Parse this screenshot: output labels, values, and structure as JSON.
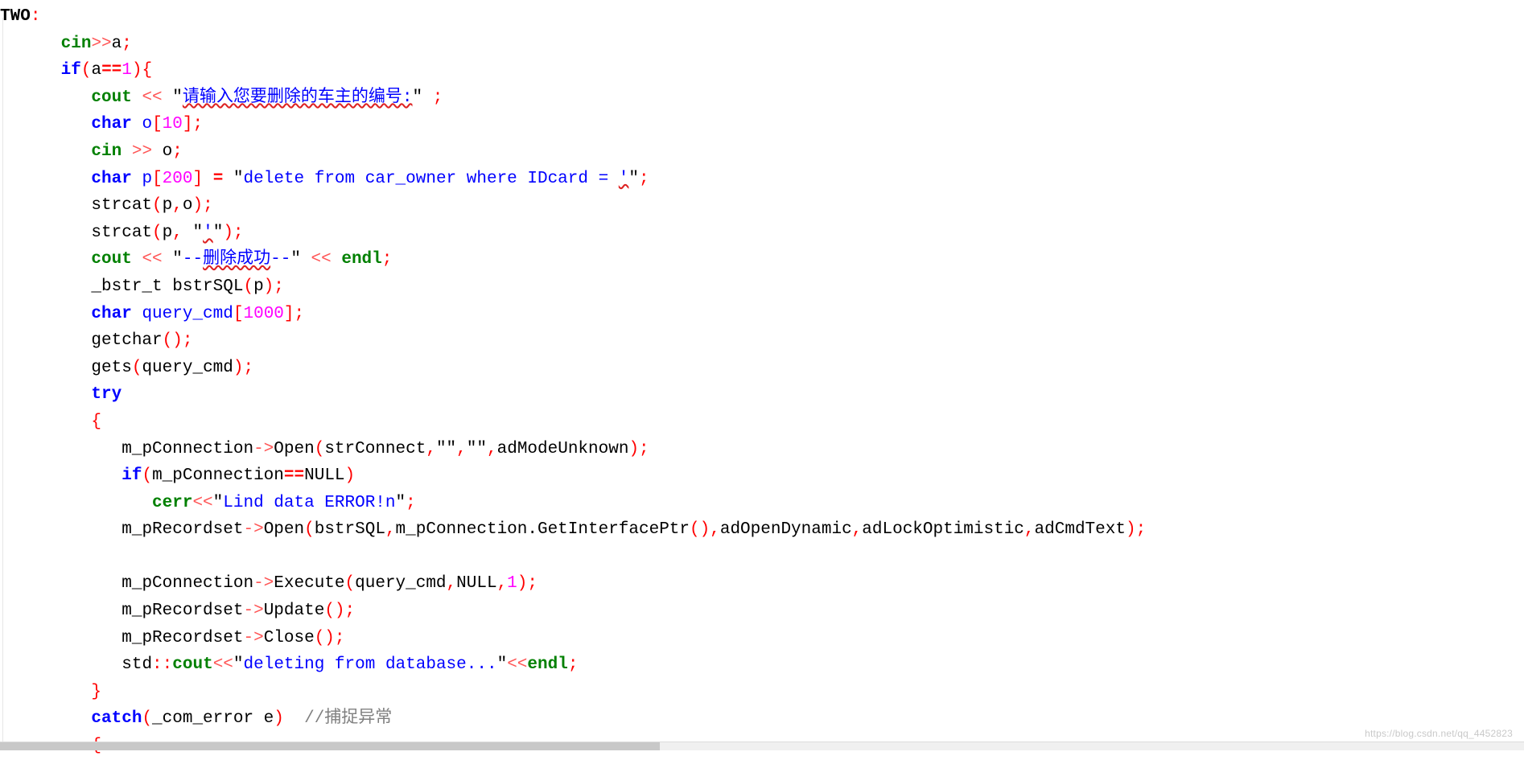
{
  "editor": {
    "language": "C++",
    "background_color": "#ffffff",
    "font_size_px": 21,
    "colors": {
      "keyword": "#0000ff",
      "stream_object": "#008000",
      "operator": "#ff5555",
      "punctuation": "#ff0000",
      "number": "#ff00ff",
      "string": "#0000ff",
      "comment": "#808080",
      "plain_text": "#000000",
      "spell_squiggle": "#dd2222"
    }
  },
  "watermark": {
    "text": "https://blog.csdn.net/qq_4452823"
  },
  "code": {
    "lines": [
      {
        "id": "line-label-two",
        "indent": 0,
        "text": "TWO:",
        "tokens": [
          {
            "t": "TWO",
            "c": "label"
          },
          {
            "t": ":",
            "c": "punct"
          }
        ]
      },
      {
        "id": "line-cin-a",
        "indent": 6,
        "text": "cin>>a;",
        "tokens": [
          {
            "t": "cin",
            "c": "stream"
          },
          {
            "t": ">>",
            "c": "op"
          },
          {
            "t": "a",
            "c": "ident"
          },
          {
            "t": ";",
            "c": "punct"
          }
        ]
      },
      {
        "id": "line-if-a-eq-1",
        "indent": 6,
        "text": "if(a==1){",
        "tokens": [
          {
            "t": "if",
            "c": "kw"
          },
          {
            "t": "(",
            "c": "punct"
          },
          {
            "t": "a",
            "c": "ident"
          },
          {
            "t": "==",
            "c": "eq"
          },
          {
            "t": "1",
            "c": "num"
          },
          {
            "t": ")",
            "c": "punct"
          },
          {
            "t": "{",
            "c": "brace"
          }
        ]
      },
      {
        "id": "line-cout-prompt",
        "indent": 9,
        "text": "cout << \"请输入您要删除的车主的编号:\" ;",
        "tokens": [
          {
            "t": "cout",
            "c": "stream"
          },
          {
            "t": " << ",
            "c": "op"
          },
          {
            "t": "\"",
            "c": "strq"
          },
          {
            "t": "请输入您要删除的车主的编号:",
            "c": "cn squiggle"
          },
          {
            "t": "\"",
            "c": "strq"
          },
          {
            "t": " ;",
            "c": "punct"
          }
        ]
      },
      {
        "id": "line-char-o-10",
        "indent": 9,
        "text": "char o[10];",
        "tokens": [
          {
            "t": "char",
            "c": "kw"
          },
          {
            "t": " o",
            "c": "type"
          },
          {
            "t": "[",
            "c": "punct"
          },
          {
            "t": "10",
            "c": "num"
          },
          {
            "t": "]",
            "c": "punct"
          },
          {
            "t": ";",
            "c": "punct"
          }
        ]
      },
      {
        "id": "line-cin-o",
        "indent": 9,
        "text": "cin >> o;",
        "tokens": [
          {
            "t": "cin",
            "c": "stream"
          },
          {
            "t": " >> ",
            "c": "op"
          },
          {
            "t": "o",
            "c": "ident"
          },
          {
            "t": ";",
            "c": "punct"
          }
        ]
      },
      {
        "id": "line-char-p-200",
        "indent": 9,
        "text": "char p[200] = \"delete from car_owner where IDcard = '\";",
        "tokens": [
          {
            "t": "char",
            "c": "kw"
          },
          {
            "t": " p",
            "c": "type"
          },
          {
            "t": "[",
            "c": "punct"
          },
          {
            "t": "200",
            "c": "num"
          },
          {
            "t": "]",
            "c": "punct"
          },
          {
            "t": " = ",
            "c": "eq"
          },
          {
            "t": "\"",
            "c": "strq"
          },
          {
            "t": "delete from car_owner where IDcard = ",
            "c": "str"
          },
          {
            "t": "'",
            "c": "str squiggle"
          },
          {
            "t": "\"",
            "c": "strq"
          },
          {
            "t": ";",
            "c": "punct"
          }
        ]
      },
      {
        "id": "line-strcat-p-o",
        "indent": 9,
        "text": "strcat(p,o);",
        "tokens": [
          {
            "t": "strcat",
            "c": "ident"
          },
          {
            "t": "(",
            "c": "punct"
          },
          {
            "t": "p",
            "c": "ident"
          },
          {
            "t": ",",
            "c": "punct"
          },
          {
            "t": "o",
            "c": "ident"
          },
          {
            "t": ")",
            "c": "punct"
          },
          {
            "t": ";",
            "c": "punct"
          }
        ]
      },
      {
        "id": "line-strcat-p-quote",
        "indent": 9,
        "text": "strcat(p, \"'\");",
        "tokens": [
          {
            "t": "strcat",
            "c": "ident"
          },
          {
            "t": "(",
            "c": "punct"
          },
          {
            "t": "p",
            "c": "ident"
          },
          {
            "t": ", ",
            "c": "punct"
          },
          {
            "t": "\"",
            "c": "strq"
          },
          {
            "t": "'",
            "c": "str squiggle"
          },
          {
            "t": "\"",
            "c": "strq"
          },
          {
            "t": ")",
            "c": "punct"
          },
          {
            "t": ";",
            "c": "punct"
          }
        ]
      },
      {
        "id": "line-cout-success",
        "indent": 9,
        "text": "cout << \"--删除成功--\" << endl;",
        "tokens": [
          {
            "t": "cout",
            "c": "stream"
          },
          {
            "t": " << ",
            "c": "op"
          },
          {
            "t": "\"",
            "c": "strq"
          },
          {
            "t": "--",
            "c": "str"
          },
          {
            "t": "删除成功",
            "c": "cn squiggle"
          },
          {
            "t": "--",
            "c": "str"
          },
          {
            "t": "\"",
            "c": "strq"
          },
          {
            "t": " << ",
            "c": "op"
          },
          {
            "t": "endl",
            "c": "stream"
          },
          {
            "t": ";",
            "c": "punct"
          }
        ]
      },
      {
        "id": "line-bstr-t",
        "indent": 9,
        "text": "_bstr_t bstrSQL(p);",
        "tokens": [
          {
            "t": "_bstr_t bstrSQL",
            "c": "ident"
          },
          {
            "t": "(",
            "c": "punct"
          },
          {
            "t": "p",
            "c": "ident"
          },
          {
            "t": ")",
            "c": "punct"
          },
          {
            "t": ";",
            "c": "punct"
          }
        ]
      },
      {
        "id": "line-char-query-cmd",
        "indent": 9,
        "text": "char query_cmd[1000];",
        "tokens": [
          {
            "t": "char",
            "c": "kw"
          },
          {
            "t": " query_cmd",
            "c": "type"
          },
          {
            "t": "[",
            "c": "punct"
          },
          {
            "t": "1000",
            "c": "num"
          },
          {
            "t": "]",
            "c": "punct"
          },
          {
            "t": ";",
            "c": "punct"
          }
        ]
      },
      {
        "id": "line-getchar",
        "indent": 9,
        "text": "getchar();",
        "tokens": [
          {
            "t": "getchar",
            "c": "ident"
          },
          {
            "t": "()",
            "c": "punct"
          },
          {
            "t": ";",
            "c": "punct"
          }
        ]
      },
      {
        "id": "line-gets",
        "indent": 9,
        "text": "gets(query_cmd);",
        "tokens": [
          {
            "t": "gets",
            "c": "ident"
          },
          {
            "t": "(",
            "c": "punct"
          },
          {
            "t": "query_cmd",
            "c": "ident"
          },
          {
            "t": ")",
            "c": "punct"
          },
          {
            "t": ";",
            "c": "punct"
          }
        ]
      },
      {
        "id": "line-try",
        "indent": 9,
        "text": "try",
        "tokens": [
          {
            "t": "try",
            "c": "kw"
          }
        ]
      },
      {
        "id": "line-try-open-brace",
        "indent": 9,
        "text": "{",
        "tokens": [
          {
            "t": "{",
            "c": "brace"
          }
        ]
      },
      {
        "id": "line-conn-open",
        "indent": 12,
        "text": "m_pConnection->Open(strConnect,\"\",\"\",adModeUnknown);",
        "tokens": [
          {
            "t": "m_pConnection",
            "c": "ident"
          },
          {
            "t": "->",
            "c": "op"
          },
          {
            "t": "Open",
            "c": "ident"
          },
          {
            "t": "(",
            "c": "punct"
          },
          {
            "t": "strConnect",
            "c": "ident"
          },
          {
            "t": ",",
            "c": "punct"
          },
          {
            "t": "\"\"",
            "c": "strq"
          },
          {
            "t": ",",
            "c": "punct"
          },
          {
            "t": "\"\"",
            "c": "strq"
          },
          {
            "t": ",",
            "c": "punct"
          },
          {
            "t": "adModeUnknown",
            "c": "ident"
          },
          {
            "t": ")",
            "c": "punct"
          },
          {
            "t": ";",
            "c": "punct"
          }
        ]
      },
      {
        "id": "line-if-conn-null",
        "indent": 12,
        "text": "if(m_pConnection==NULL)",
        "tokens": [
          {
            "t": "if",
            "c": "kw"
          },
          {
            "t": "(",
            "c": "punct"
          },
          {
            "t": "m_pConnection",
            "c": "ident"
          },
          {
            "t": "==",
            "c": "eq"
          },
          {
            "t": "NULL",
            "c": "ident"
          },
          {
            "t": ")",
            "c": "punct"
          }
        ]
      },
      {
        "id": "line-cerr-lind",
        "indent": 15,
        "text": "cerr<<\"Lind data ERROR!n\";",
        "tokens": [
          {
            "t": "cerr",
            "c": "stream"
          },
          {
            "t": "<<",
            "c": "op"
          },
          {
            "t": "\"",
            "c": "strq"
          },
          {
            "t": "Lind data ERROR!n",
            "c": "str"
          },
          {
            "t": "\"",
            "c": "strq"
          },
          {
            "t": ";",
            "c": "punct"
          }
        ]
      },
      {
        "id": "line-recordset-open",
        "indent": 12,
        "text": "m_pRecordset->Open(bstrSQL,m_pConnection.GetInterfacePtr(),adOpenDynamic,adLockOptimistic,adCmdText);",
        "tokens": [
          {
            "t": "m_pRecordset",
            "c": "ident"
          },
          {
            "t": "->",
            "c": "op"
          },
          {
            "t": "Open",
            "c": "ident"
          },
          {
            "t": "(",
            "c": "punct"
          },
          {
            "t": "bstrSQL",
            "c": "ident"
          },
          {
            "t": ",",
            "c": "punct"
          },
          {
            "t": "m_pConnection.GetInterfacePtr",
            "c": "ident"
          },
          {
            "t": "()",
            "c": "punct"
          },
          {
            "t": ",",
            "c": "punct"
          },
          {
            "t": "adOpenDynamic",
            "c": "ident"
          },
          {
            "t": ",",
            "c": "punct"
          },
          {
            "t": "adLockOptimistic",
            "c": "ident"
          },
          {
            "t": ",",
            "c": "punct"
          },
          {
            "t": "adCmdText",
            "c": "ident"
          },
          {
            "t": ")",
            "c": "punct"
          },
          {
            "t": ";",
            "c": "punct"
          }
        ]
      },
      {
        "id": "line-blank-1",
        "indent": 0,
        "text": "",
        "tokens": []
      },
      {
        "id": "line-conn-execute",
        "indent": 12,
        "text": "m_pConnection->Execute(query_cmd,NULL,1);",
        "tokens": [
          {
            "t": "m_pConnection",
            "c": "ident"
          },
          {
            "t": "->",
            "c": "op"
          },
          {
            "t": "Execute",
            "c": "ident"
          },
          {
            "t": "(",
            "c": "punct"
          },
          {
            "t": "query_cmd",
            "c": "ident"
          },
          {
            "t": ",",
            "c": "punct"
          },
          {
            "t": "NULL",
            "c": "ident"
          },
          {
            "t": ",",
            "c": "punct"
          },
          {
            "t": "1",
            "c": "num"
          },
          {
            "t": ")",
            "c": "punct"
          },
          {
            "t": ";",
            "c": "punct"
          }
        ]
      },
      {
        "id": "line-recordset-update",
        "indent": 12,
        "text": "m_pRecordset->Update();",
        "tokens": [
          {
            "t": "m_pRecordset",
            "c": "ident"
          },
          {
            "t": "->",
            "c": "op"
          },
          {
            "t": "Update",
            "c": "ident"
          },
          {
            "t": "()",
            "c": "punct"
          },
          {
            "t": ";",
            "c": "punct"
          }
        ]
      },
      {
        "id": "line-recordset-close",
        "indent": 12,
        "text": "m_pRecordset->Close();",
        "tokens": [
          {
            "t": "m_pRecordset",
            "c": "ident"
          },
          {
            "t": "->",
            "c": "op"
          },
          {
            "t": "Close",
            "c": "ident"
          },
          {
            "t": "()",
            "c": "punct"
          },
          {
            "t": ";",
            "c": "punct"
          }
        ]
      },
      {
        "id": "line-std-cout-deleting",
        "indent": 12,
        "text": "std::cout<<\"deleting from database...\"<<endl;",
        "tokens": [
          {
            "t": "std",
            "c": "ident"
          },
          {
            "t": "::",
            "c": "punct"
          },
          {
            "t": "cout",
            "c": "stream"
          },
          {
            "t": "<<",
            "c": "op"
          },
          {
            "t": "\"",
            "c": "strq"
          },
          {
            "t": "deleting from database...",
            "c": "str"
          },
          {
            "t": "\"",
            "c": "strq"
          },
          {
            "t": "<<",
            "c": "op"
          },
          {
            "t": "endl",
            "c": "stream"
          },
          {
            "t": ";",
            "c": "punct"
          }
        ]
      },
      {
        "id": "line-try-close-brace",
        "indent": 9,
        "text": "}",
        "tokens": [
          {
            "t": "}",
            "c": "brace"
          }
        ]
      },
      {
        "id": "line-catch",
        "indent": 9,
        "text": "catch(_com_error e) //捕捉异常",
        "tokens": [
          {
            "t": "catch",
            "c": "kw"
          },
          {
            "t": "(",
            "c": "punct"
          },
          {
            "t": "_com_error e",
            "c": "ident"
          },
          {
            "t": ")",
            "c": "punct"
          },
          {
            "t": "  //捕捉异常",
            "c": "cmt"
          }
        ]
      },
      {
        "id": "line-catch-open-brace",
        "indent": 9,
        "text": "{",
        "tokens": [
          {
            "t": "{",
            "c": "brace"
          }
        ]
      }
    ]
  }
}
